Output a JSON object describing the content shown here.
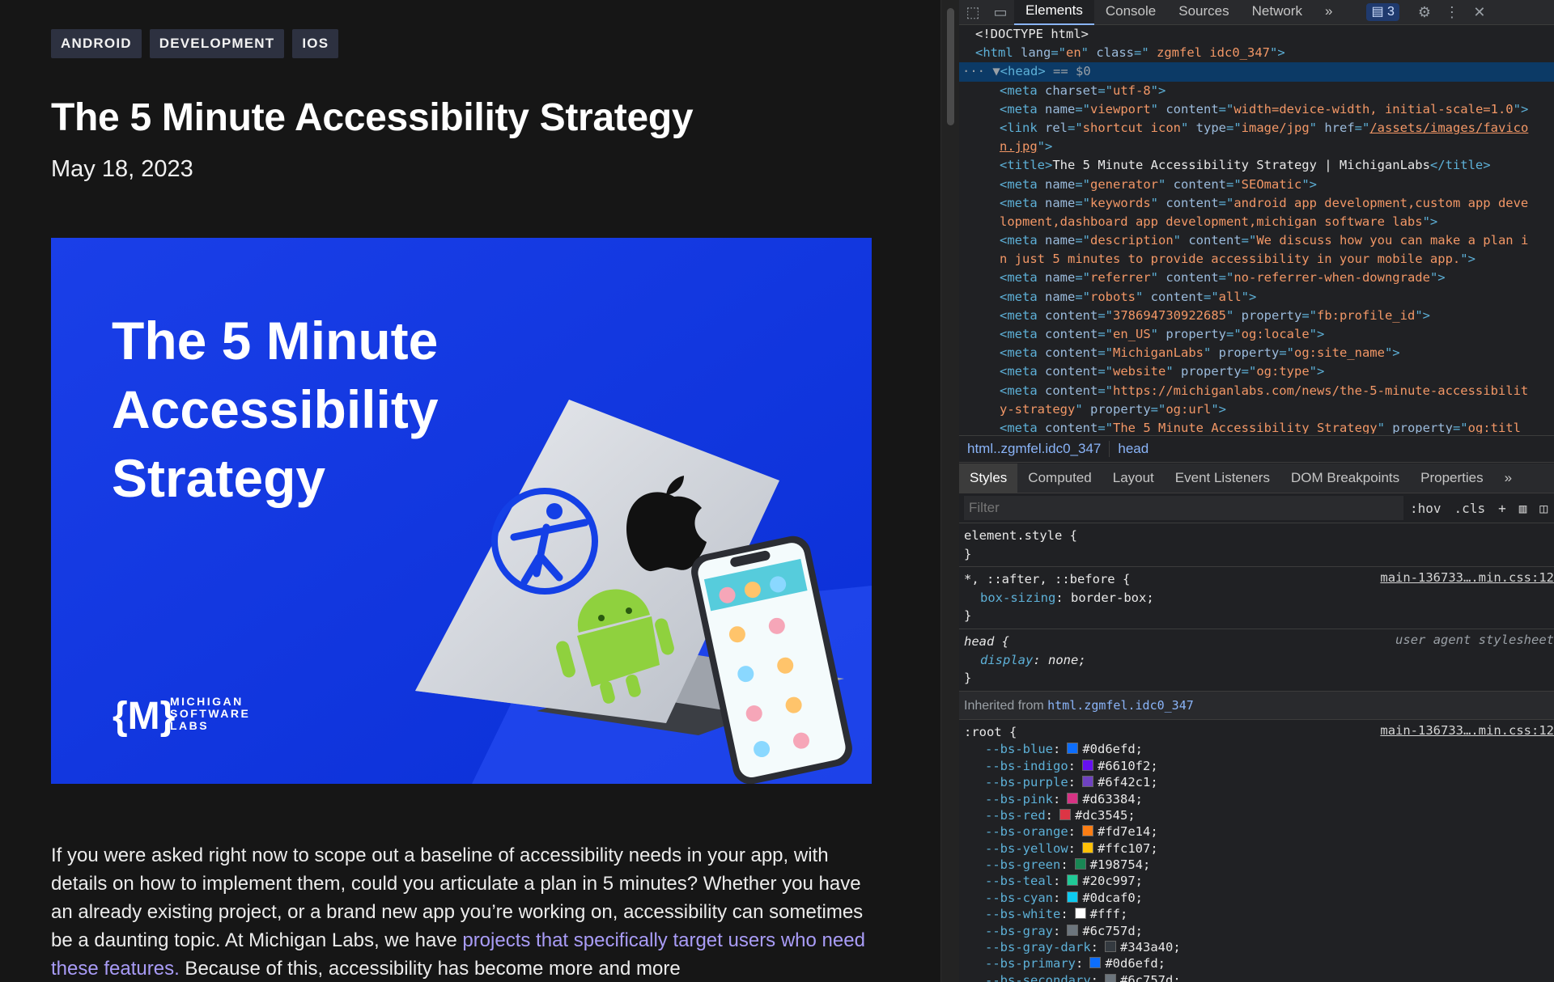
{
  "article": {
    "tags": [
      "ANDROID",
      "DEVELOPMENT",
      "IOS"
    ],
    "title": "The 5 Minute Accessibility Strategy",
    "date": "May 18, 2023",
    "hero": {
      "headline_lines": [
        "The 5 Minute",
        "Accessibility",
        "Strategy"
      ],
      "logo_mark": "{M}",
      "logo_lines": [
        "MICHIGAN",
        "SOFTWARE",
        "LABS"
      ],
      "background_color": "#0e3be6"
    },
    "body_part1": "If you were asked right now to scope out a baseline of accessibility needs in your app, with details on how to implement them, could you articulate a plan in 5 minutes? Whether you have an already existing project, or a brand new app you’re working on, accessibility can sometimes be a daunting topic. At Michigan Labs, we have ",
    "body_link": "projects that specifically target users who need these features.",
    "body_part2": " Because of this, accessibility has become more and more"
  },
  "devtools": {
    "tabs": [
      "Elements",
      "Console",
      "Sources",
      "Network"
    ],
    "more_tabs": "»",
    "issues_count": "3",
    "breadcrumb": [
      "html..zgmfel.idc0_347",
      "head"
    ],
    "style_tabs": [
      "Styles",
      "Computed",
      "Layout",
      "Event Listeners",
      "DOM Breakpoints",
      "Properties"
    ],
    "filter_placeholder": "Filter",
    "hov_label": ":hov",
    "cls_label": ".cls",
    "element_style": "element.style {",
    "rule1_selector": "*, ::after, ::before {",
    "rule1_source": "main-136733….min.css:12",
    "rule1_prop": "box-sizing",
    "rule1_val": "border-box;",
    "rule2_selector": "head {",
    "rule2_source": "user agent stylesheet",
    "rule2_prop": "display",
    "rule2_val": "none;",
    "inherited_label": "Inherited from ",
    "inherited_from": "html.zgmfel.idc0_347",
    "root_selector": ":root {",
    "root_source": "main-136733….min.css:12",
    "closing_brace": "}",
    "css_vars": [
      {
        "name": "--bs-blue",
        "value": "#0d6efd;",
        "color": "#0d6efd"
      },
      {
        "name": "--bs-indigo",
        "value": "#6610f2;",
        "color": "#6610f2"
      },
      {
        "name": "--bs-purple",
        "value": "#6f42c1;",
        "color": "#6f42c1"
      },
      {
        "name": "--bs-pink",
        "value": "#d63384;",
        "color": "#d63384"
      },
      {
        "name": "--bs-red",
        "value": "#dc3545;",
        "color": "#dc3545"
      },
      {
        "name": "--bs-orange",
        "value": "#fd7e14;",
        "color": "#fd7e14"
      },
      {
        "name": "--bs-yellow",
        "value": "#ffc107;",
        "color": "#ffc107"
      },
      {
        "name": "--bs-green",
        "value": "#198754;",
        "color": "#198754"
      },
      {
        "name": "--bs-teal",
        "value": "#20c997;",
        "color": "#20c997"
      },
      {
        "name": "--bs-cyan",
        "value": "#0dcaf0;",
        "color": "#0dcaf0"
      },
      {
        "name": "--bs-white",
        "value": "#fff;",
        "color": "#ffffff"
      },
      {
        "name": "--bs-gray",
        "value": "#6c757d;",
        "color": "#6c757d"
      },
      {
        "name": "--bs-gray-dark",
        "value": "#343a40;",
        "color": "#343a40"
      },
      {
        "name": "--bs-primary",
        "value": "#0d6efd;",
        "color": "#0d6efd"
      },
      {
        "name": "--bs-secondary",
        "value": "#6c757d;",
        "color": "#6c757d"
      }
    ],
    "html_lines": [
      {
        "parts": [
          [
            "tx",
            "<!DOCTYPE html>"
          ]
        ]
      },
      {
        "parts": [
          [
            "tg",
            "<html "
          ],
          [
            "at",
            "lang"
          ],
          [
            "tg",
            "=\""
          ],
          [
            "av",
            "en"
          ],
          [
            "tg",
            "\" "
          ],
          [
            "at",
            "class"
          ],
          [
            "tg",
            "=\""
          ],
          [
            "av",
            " zgmfel idc0_347"
          ],
          [
            "tg",
            "\">"
          ]
        ]
      },
      {
        "sel": true,
        "parts": [
          [
            "cm",
            "··· ▼"
          ],
          [
            "tg",
            "<head>"
          ],
          [
            "cm",
            " == $0"
          ]
        ]
      },
      {
        "indent": 2,
        "parts": [
          [
            "tg",
            "<meta "
          ],
          [
            "at",
            "charset"
          ],
          [
            "tg",
            "=\""
          ],
          [
            "av",
            "utf-8"
          ],
          [
            "tg",
            "\">"
          ]
        ]
      },
      {
        "indent": 2,
        "parts": [
          [
            "tg",
            "<meta "
          ],
          [
            "at",
            "name"
          ],
          [
            "tg",
            "=\""
          ],
          [
            "av",
            "viewport"
          ],
          [
            "tg",
            "\" "
          ],
          [
            "at",
            "content"
          ],
          [
            "tg",
            "=\""
          ],
          [
            "av",
            "width=device-width, initial-scale=1.0"
          ],
          [
            "tg",
            "\">"
          ]
        ]
      },
      {
        "indent": 2,
        "parts": [
          [
            "tg",
            "<link "
          ],
          [
            "at",
            "rel"
          ],
          [
            "tg",
            "=\""
          ],
          [
            "av",
            "shortcut icon"
          ],
          [
            "tg",
            "\" "
          ],
          [
            "at",
            "type"
          ],
          [
            "tg",
            "=\""
          ],
          [
            "av",
            "image/jpg"
          ],
          [
            "tg",
            "\" "
          ],
          [
            "at",
            "href"
          ],
          [
            "tg",
            "=\""
          ],
          [
            "lk",
            "/assets/images/favico"
          ]
        ]
      },
      {
        "indent": 2,
        "parts": [
          [
            "lk",
            "n.jpg"
          ],
          [
            "tg",
            "\">"
          ]
        ]
      },
      {
        "indent": 2,
        "parts": [
          [
            "tg",
            "<title>"
          ],
          [
            "tx",
            "The 5 Minute Accessibility Strategy | MichiganLabs"
          ],
          [
            "tg",
            "</title>"
          ]
        ]
      },
      {
        "indent": 2,
        "parts": [
          [
            "tg",
            "<meta "
          ],
          [
            "at",
            "name"
          ],
          [
            "tg",
            "=\""
          ],
          [
            "av",
            "generator"
          ],
          [
            "tg",
            "\" "
          ],
          [
            "at",
            "content"
          ],
          [
            "tg",
            "=\""
          ],
          [
            "av",
            "SEOmatic"
          ],
          [
            "tg",
            "\">"
          ]
        ]
      },
      {
        "indent": 2,
        "parts": [
          [
            "tg",
            "<meta "
          ],
          [
            "at",
            "name"
          ],
          [
            "tg",
            "=\""
          ],
          [
            "av",
            "keywords"
          ],
          [
            "tg",
            "\" "
          ],
          [
            "at",
            "content"
          ],
          [
            "tg",
            "=\""
          ],
          [
            "av",
            "android app development,custom app deve"
          ]
        ]
      },
      {
        "indent": 2,
        "parts": [
          [
            "av",
            "lopment,dashboard app development,michigan software labs"
          ],
          [
            "tg",
            "\">"
          ]
        ]
      },
      {
        "indent": 2,
        "parts": [
          [
            "tg",
            "<meta "
          ],
          [
            "at",
            "name"
          ],
          [
            "tg",
            "=\""
          ],
          [
            "av",
            "description"
          ],
          [
            "tg",
            "\" "
          ],
          [
            "at",
            "content"
          ],
          [
            "tg",
            "=\""
          ],
          [
            "av",
            "We discuss how you can make a plan i"
          ]
        ]
      },
      {
        "indent": 2,
        "parts": [
          [
            "av",
            "n just 5 minutes to provide accessibility in your mobile app."
          ],
          [
            "tg",
            "\">"
          ]
        ]
      },
      {
        "indent": 2,
        "parts": [
          [
            "tg",
            "<meta "
          ],
          [
            "at",
            "name"
          ],
          [
            "tg",
            "=\""
          ],
          [
            "av",
            "referrer"
          ],
          [
            "tg",
            "\" "
          ],
          [
            "at",
            "content"
          ],
          [
            "tg",
            "=\""
          ],
          [
            "av",
            "no-referrer-when-downgrade"
          ],
          [
            "tg",
            "\">"
          ]
        ]
      },
      {
        "indent": 2,
        "parts": [
          [
            "tg",
            "<meta "
          ],
          [
            "at",
            "name"
          ],
          [
            "tg",
            "=\""
          ],
          [
            "av",
            "robots"
          ],
          [
            "tg",
            "\" "
          ],
          [
            "at",
            "content"
          ],
          [
            "tg",
            "=\""
          ],
          [
            "av",
            "all"
          ],
          [
            "tg",
            "\">"
          ]
        ]
      },
      {
        "indent": 2,
        "parts": [
          [
            "tg",
            "<meta "
          ],
          [
            "at",
            "content"
          ],
          [
            "tg",
            "=\""
          ],
          [
            "av",
            "378694730922685"
          ],
          [
            "tg",
            "\" "
          ],
          [
            "at",
            "property"
          ],
          [
            "tg",
            "=\""
          ],
          [
            "av",
            "fb:profile_id"
          ],
          [
            "tg",
            "\">"
          ]
        ]
      },
      {
        "indent": 2,
        "parts": [
          [
            "tg",
            "<meta "
          ],
          [
            "at",
            "content"
          ],
          [
            "tg",
            "=\""
          ],
          [
            "av",
            "en_US"
          ],
          [
            "tg",
            "\" "
          ],
          [
            "at",
            "property"
          ],
          [
            "tg",
            "=\""
          ],
          [
            "av",
            "og:locale"
          ],
          [
            "tg",
            "\">"
          ]
        ]
      },
      {
        "indent": 2,
        "parts": [
          [
            "tg",
            "<meta "
          ],
          [
            "at",
            "content"
          ],
          [
            "tg",
            "=\""
          ],
          [
            "av",
            "MichiganLabs"
          ],
          [
            "tg",
            "\" "
          ],
          [
            "at",
            "property"
          ],
          [
            "tg",
            "=\""
          ],
          [
            "av",
            "og:site_name"
          ],
          [
            "tg",
            "\">"
          ]
        ]
      },
      {
        "indent": 2,
        "parts": [
          [
            "tg",
            "<meta "
          ],
          [
            "at",
            "content"
          ],
          [
            "tg",
            "=\""
          ],
          [
            "av",
            "website"
          ],
          [
            "tg",
            "\" "
          ],
          [
            "at",
            "property"
          ],
          [
            "tg",
            "=\""
          ],
          [
            "av",
            "og:type"
          ],
          [
            "tg",
            "\">"
          ]
        ]
      },
      {
        "indent": 2,
        "parts": [
          [
            "tg",
            "<meta "
          ],
          [
            "at",
            "content"
          ],
          [
            "tg",
            "=\""
          ],
          [
            "av",
            "https://michiganlabs.com/news/the-5-minute-accessibilit"
          ]
        ]
      },
      {
        "indent": 2,
        "parts": [
          [
            "av",
            "y-strategy"
          ],
          [
            "tg",
            "\" "
          ],
          [
            "at",
            "property"
          ],
          [
            "tg",
            "=\""
          ],
          [
            "av",
            "og:url"
          ],
          [
            "tg",
            "\">"
          ]
        ]
      },
      {
        "indent": 2,
        "parts": [
          [
            "tg",
            "<meta "
          ],
          [
            "at",
            "content"
          ],
          [
            "tg",
            "=\""
          ],
          [
            "av",
            "The 5 Minute Accessibility Strategy"
          ],
          [
            "tg",
            "\" "
          ],
          [
            "at",
            "property"
          ],
          [
            "tg",
            "=\""
          ],
          [
            "av",
            "og:titl"
          ]
        ]
      }
    ]
  }
}
